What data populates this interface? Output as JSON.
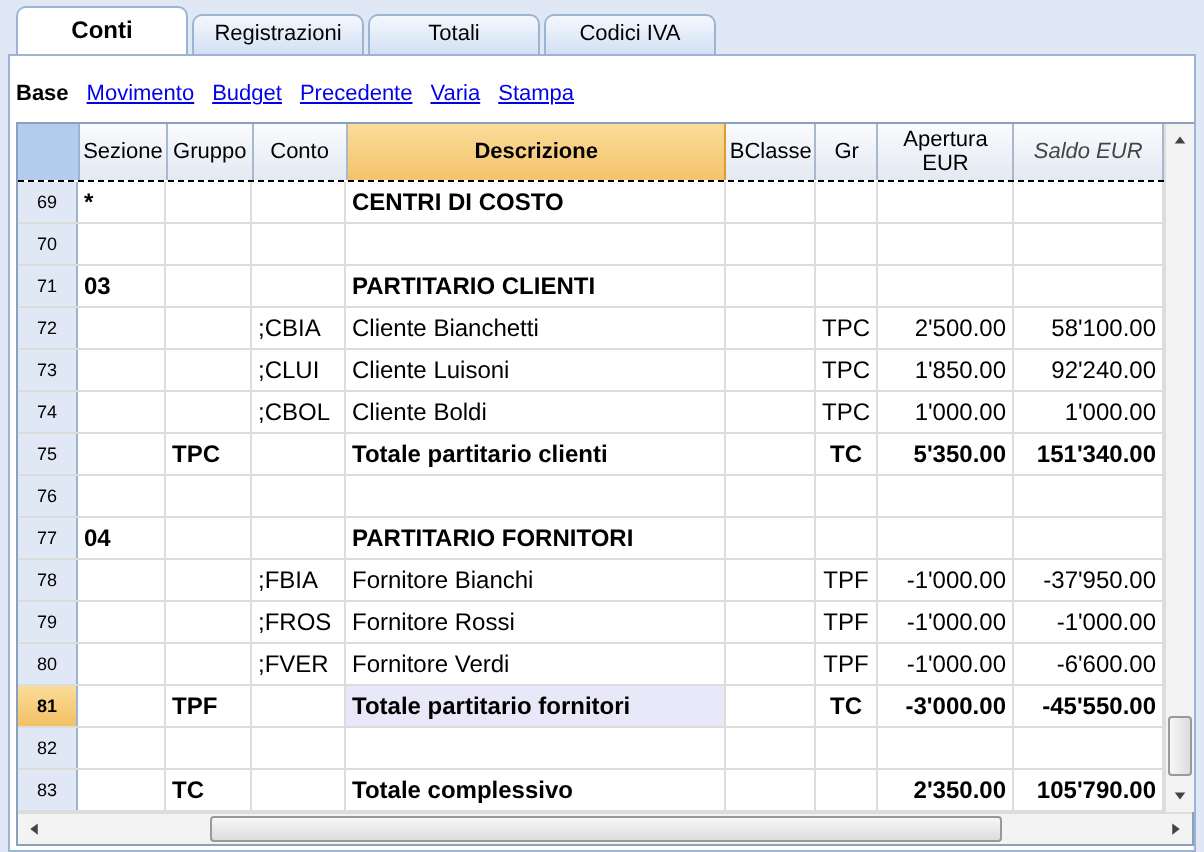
{
  "tabs": [
    {
      "label": "Conti",
      "selected": true
    },
    {
      "label": "Registrazioni",
      "selected": false
    },
    {
      "label": "Totali",
      "selected": false
    },
    {
      "label": "Codici IVA",
      "selected": false
    }
  ],
  "views": [
    {
      "label": "Base",
      "selected": true
    },
    {
      "label": "Movimento",
      "selected": false
    },
    {
      "label": "Budget",
      "selected": false
    },
    {
      "label": "Precedente",
      "selected": false
    },
    {
      "label": "Varia",
      "selected": false
    },
    {
      "label": "Stampa",
      "selected": false
    }
  ],
  "table": {
    "columns": [
      {
        "label": "Sezione",
        "kind": "text",
        "current": false,
        "italic": false
      },
      {
        "label": "Gruppo",
        "kind": "text",
        "current": false,
        "italic": false
      },
      {
        "label": "Conto",
        "kind": "text",
        "current": false,
        "italic": false
      },
      {
        "label": "Descrizione",
        "kind": "text",
        "current": true,
        "italic": false
      },
      {
        "label": "BClasse",
        "kind": "text",
        "current": false,
        "italic": false
      },
      {
        "label": "Gr",
        "kind": "code",
        "current": false,
        "italic": false
      },
      {
        "label": "Apertura EUR",
        "kind": "amount",
        "current": false,
        "italic": false
      },
      {
        "label": "Saldo EUR",
        "kind": "amount",
        "current": false,
        "italic": true
      }
    ],
    "rows": [
      {
        "number": "69",
        "bold": true,
        "selected": false,
        "cells": [
          "*",
          "",
          "",
          "CENTRI DI COSTO",
          "",
          "",
          "",
          ""
        ]
      },
      {
        "number": "70",
        "selected": false,
        "cells": [
          "",
          "",
          "",
          "",
          "",
          "",
          "",
          ""
        ]
      },
      {
        "number": "71",
        "bold": true,
        "selected": false,
        "cells": [
          "03",
          "",
          "",
          "PARTITARIO CLIENTI",
          "",
          "",
          "",
          ""
        ]
      },
      {
        "number": "72",
        "bold": false,
        "selected": false,
        "cells": [
          "",
          "",
          ";CBIA",
          "Cliente Bianchetti",
          "",
          "TPC",
          "2'500.00",
          "58'100.00"
        ]
      },
      {
        "number": "73",
        "bold": false,
        "selected": false,
        "cells": [
          "",
          "",
          ";CLUI",
          "Cliente Luisoni",
          "",
          "TPC",
          "1'850.00",
          "92'240.00"
        ]
      },
      {
        "number": "74",
        "bold": false,
        "selected": false,
        "cells": [
          "",
          "",
          ";CBOL",
          "Cliente Boldi",
          "",
          "TPC",
          "1'000.00",
          "1'000.00"
        ]
      },
      {
        "number": "75",
        "bold": true,
        "selected": false,
        "cells": [
          "",
          "TPC",
          "",
          "Totale partitario clienti",
          "",
          "TC",
          "5'350.00",
          "151'340.00"
        ]
      },
      {
        "number": "76",
        "selected": false,
        "cells": [
          "",
          "",
          "",
          "",
          "",
          "",
          "",
          ""
        ]
      },
      {
        "number": "77",
        "bold": true,
        "selected": false,
        "cells": [
          "04",
          "",
          "",
          "PARTITARIO FORNITORI",
          "",
          "",
          "",
          ""
        ]
      },
      {
        "number": "78",
        "bold": false,
        "selected": false,
        "cells": [
          "",
          "",
          ";FBIA",
          "Fornitore Bianchi",
          "",
          "TPF",
          "-1'000.00",
          "-37'950.00"
        ]
      },
      {
        "number": "79",
        "bold": false,
        "selected": false,
        "cells": [
          "",
          "",
          ";FROS",
          "Fornitore Rossi",
          "",
          "TPF",
          "-1'000.00",
          "-1'000.00"
        ]
      },
      {
        "number": "80",
        "bold": false,
        "selected": false,
        "cells": [
          "",
          "",
          ";FVER",
          "Fornitore Verdi",
          "",
          "TPF",
          "-1'000.00",
          "-6'600.00"
        ]
      },
      {
        "number": "81",
        "bold": true,
        "selected": true,
        "cells": [
          "",
          "TPF",
          "",
          "Totale partitario fornitori",
          "",
          "TC",
          "-3'000.00",
          "-45'550.00"
        ]
      },
      {
        "number": "82",
        "selected": false,
        "cells": [
          "",
          "",
          "",
          "",
          "",
          "",
          "",
          ""
        ]
      },
      {
        "number": "83",
        "bold": true,
        "selected": false,
        "cells": [
          "",
          "TC",
          "",
          "Totale complessivo",
          "",
          "",
          "2'350.00",
          "105'790.00"
        ]
      }
    ]
  }
}
